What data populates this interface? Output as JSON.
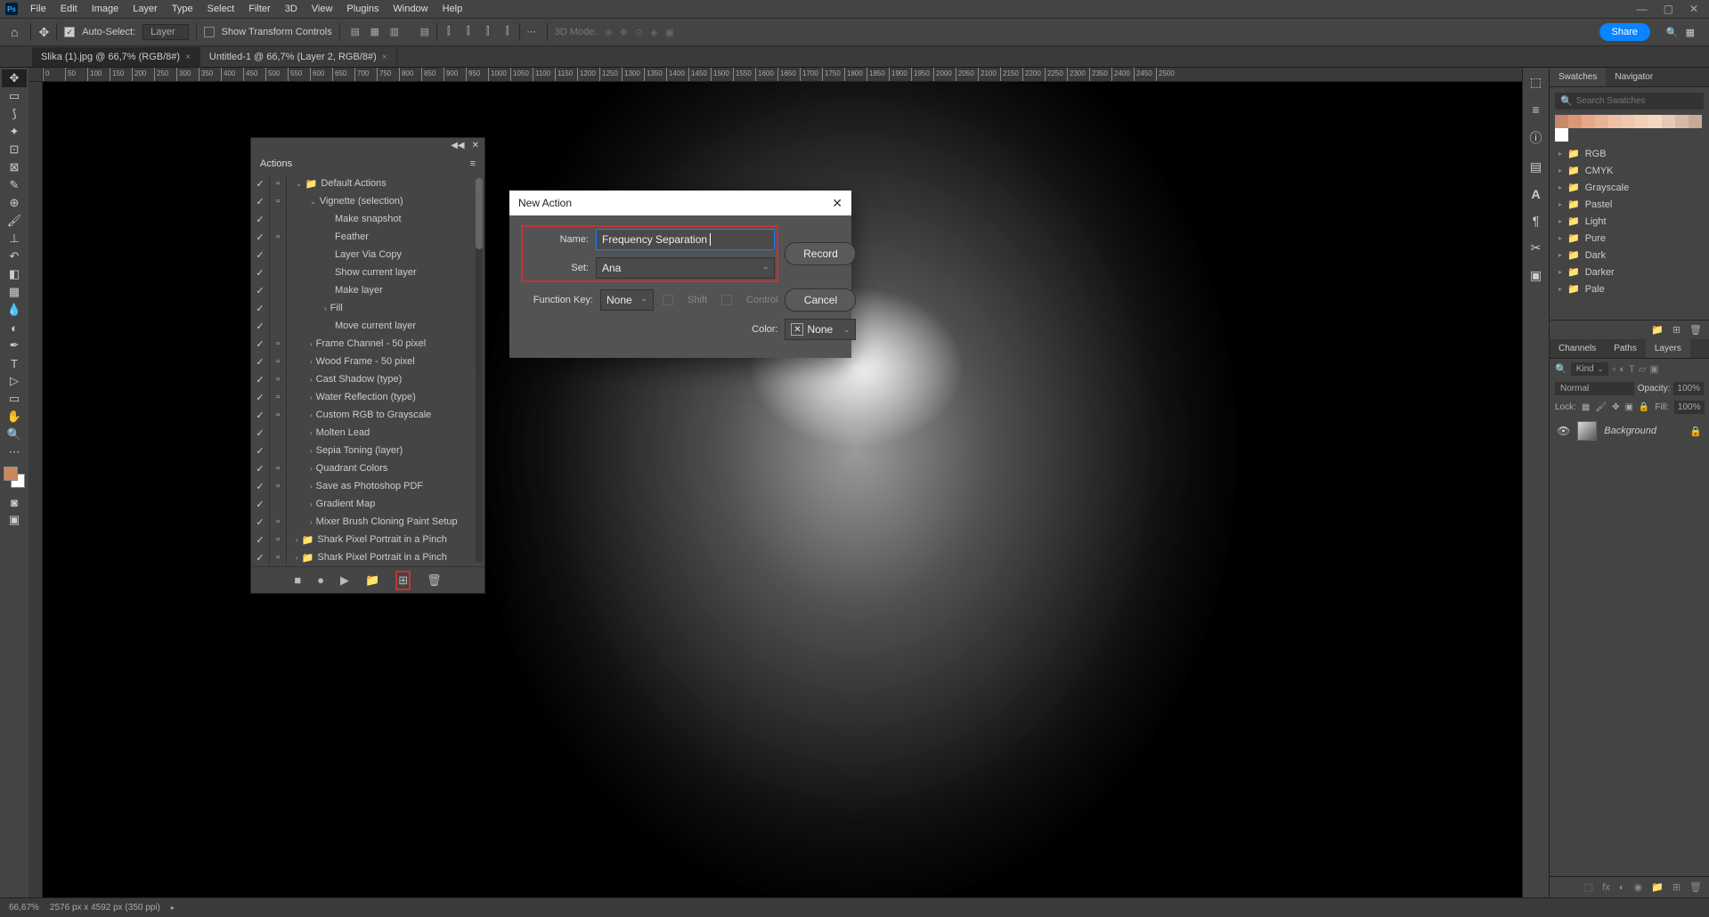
{
  "menubar": [
    "File",
    "Edit",
    "Image",
    "Layer",
    "Type",
    "Select",
    "Filter",
    "3D",
    "View",
    "Plugins",
    "Window",
    "Help"
  ],
  "options": {
    "auto_select": "Auto-Select:",
    "layer_dropdown": "Layer",
    "show_transform": "Show Transform Controls",
    "mode_3d": "3D Mode:",
    "share": "Share"
  },
  "doc_tabs": [
    {
      "label": "Slika (1).jpg @ 66,7% (RGB/8#)",
      "active": true
    },
    {
      "label": "Untitled-1 @ 66,7% (Layer 2, RGB/8#)",
      "active": false
    }
  ],
  "ruler_marks": [
    0,
    50,
    100,
    150,
    200,
    250,
    300,
    350,
    400,
    450,
    500,
    550,
    600,
    650,
    700,
    750,
    800,
    850,
    900,
    950,
    1000,
    1050,
    1100,
    1150,
    1200,
    1250,
    1300,
    1350,
    1400,
    1450,
    1500,
    1550,
    1600,
    1650,
    1700,
    1750,
    1800,
    1850,
    1900,
    1950,
    2000,
    2050,
    2100,
    2150,
    2200,
    2250,
    2300,
    2350,
    2400,
    2450,
    2500
  ],
  "actions_panel": {
    "title": "Actions",
    "rows": [
      {
        "check": true,
        "dialog": true,
        "indent": 0,
        "arrow": "v",
        "icon": "folder",
        "label": "Default Actions"
      },
      {
        "check": true,
        "dialog": true,
        "indent": 1,
        "arrow": "v",
        "icon": "",
        "label": "Vignette (selection)"
      },
      {
        "check": true,
        "dialog": false,
        "indent": 2,
        "arrow": "",
        "icon": "",
        "label": "Make snapshot"
      },
      {
        "check": true,
        "dialog": true,
        "indent": 2,
        "arrow": "",
        "icon": "",
        "label": "Feather"
      },
      {
        "check": true,
        "dialog": false,
        "indent": 2,
        "arrow": "",
        "icon": "",
        "label": "Layer Via Copy"
      },
      {
        "check": true,
        "dialog": false,
        "indent": 2,
        "arrow": "",
        "icon": "",
        "label": "Show current layer"
      },
      {
        "check": true,
        "dialog": false,
        "indent": 2,
        "arrow": "",
        "icon": "",
        "label": "Make layer"
      },
      {
        "check": true,
        "dialog": false,
        "indent": 2,
        "arrow": ">",
        "icon": "",
        "label": "Fill"
      },
      {
        "check": true,
        "dialog": false,
        "indent": 2,
        "arrow": "",
        "icon": "",
        "label": "Move current layer"
      },
      {
        "check": true,
        "dialog": true,
        "indent": 1,
        "arrow": ">",
        "icon": "",
        "label": "Frame Channel - 50 pixel"
      },
      {
        "check": true,
        "dialog": true,
        "indent": 1,
        "arrow": ">",
        "icon": "",
        "label": "Wood Frame - 50 pixel"
      },
      {
        "check": true,
        "dialog": true,
        "indent": 1,
        "arrow": ">",
        "icon": "",
        "label": "Cast Shadow (type)"
      },
      {
        "check": true,
        "dialog": true,
        "indent": 1,
        "arrow": ">",
        "icon": "",
        "label": "Water Reflection (type)"
      },
      {
        "check": true,
        "dialog": true,
        "indent": 1,
        "arrow": ">",
        "icon": "",
        "label": "Custom RGB to Grayscale"
      },
      {
        "check": true,
        "dialog": false,
        "indent": 1,
        "arrow": ">",
        "icon": "",
        "label": "Molten Lead"
      },
      {
        "check": true,
        "dialog": false,
        "indent": 1,
        "arrow": ">",
        "icon": "",
        "label": "Sepia Toning (layer)"
      },
      {
        "check": true,
        "dialog": true,
        "indent": 1,
        "arrow": ">",
        "icon": "",
        "label": "Quadrant Colors"
      },
      {
        "check": true,
        "dialog": true,
        "indent": 1,
        "arrow": ">",
        "icon": "",
        "label": "Save as Photoshop PDF"
      },
      {
        "check": true,
        "dialog": false,
        "indent": 1,
        "arrow": ">",
        "icon": "",
        "label": "Gradient Map"
      },
      {
        "check": true,
        "dialog": true,
        "indent": 1,
        "arrow": ">",
        "icon": "",
        "label": "Mixer Brush Cloning Paint Setup"
      },
      {
        "check": true,
        "dialog": true,
        "indent": 0,
        "arrow": ">",
        "icon": "folder",
        "label": "Shark Pixel Portrait in a Pinch"
      },
      {
        "check": true,
        "dialog": true,
        "indent": 0,
        "arrow": ">",
        "icon": "folder",
        "label": "Shark Pixel Portrait in a Pinch"
      }
    ]
  },
  "new_action_dialog": {
    "title": "New Action",
    "name_label": "Name:",
    "name_value": "Frequency Separation",
    "set_label": "Set:",
    "set_value": "Ana",
    "fkey_label": "Function Key:",
    "fkey_value": "None",
    "shift": "Shift",
    "control": "Control",
    "color_label": "Color:",
    "color_value": "None",
    "record": "Record",
    "cancel": "Cancel"
  },
  "swatches_panel": {
    "tabs": [
      "Swatches",
      "Navigator"
    ],
    "search_placeholder": "Search Swatches",
    "colors": [
      "#c8886a",
      "#d89878",
      "#e8a888",
      "#e8b498",
      "#eec0a8",
      "#f0c8b0",
      "#f2d0b8",
      "#f4d8c0",
      "#e8c8b8",
      "#d8b8a8",
      "#c8a898",
      "#ffffff"
    ],
    "groups": [
      "RGB",
      "CMYK",
      "Grayscale",
      "Pastel",
      "Light",
      "Pure",
      "Dark",
      "Darker",
      "Pale"
    ]
  },
  "layers_panel": {
    "tabs": [
      "Channels",
      "Paths",
      "Layers"
    ],
    "kind": "Kind",
    "blend_mode": "Normal",
    "opacity_label": "Opacity:",
    "opacity_value": "100%",
    "lock_label": "Lock:",
    "fill_label": "Fill:",
    "fill_value": "100%",
    "layers": [
      {
        "name": "Background",
        "locked": true
      }
    ]
  },
  "statusbar": {
    "zoom": "66,67%",
    "doc_info": "2576 px x 4592 px (350 ppi)"
  }
}
